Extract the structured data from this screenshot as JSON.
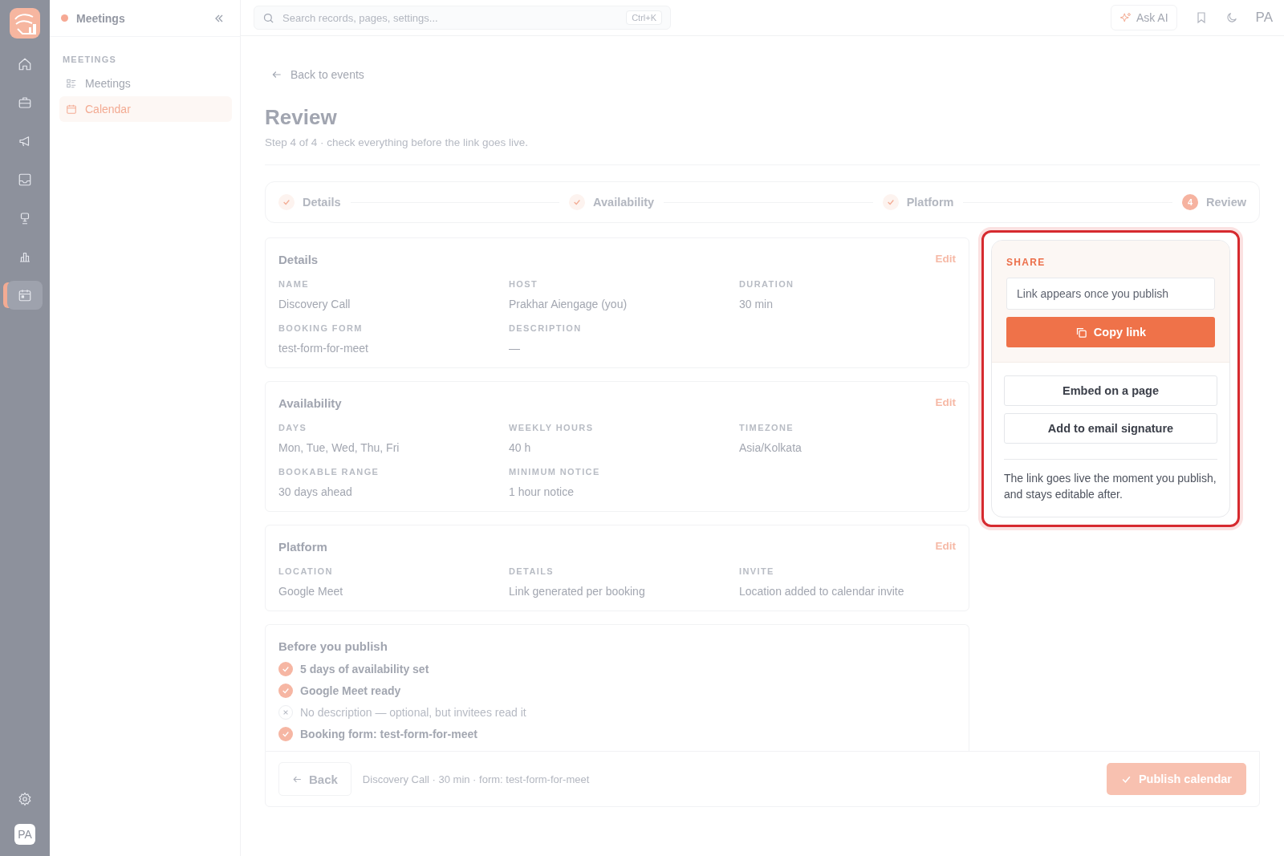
{
  "rail": {
    "items": [
      {
        "selected": false
      },
      {
        "selected": false
      },
      {
        "selected": false
      },
      {
        "selected": false
      },
      {
        "selected": false
      },
      {
        "selected": false
      },
      {
        "selected": true
      }
    ],
    "avatar": "PA"
  },
  "sidebar": {
    "title": "Meetings",
    "section": "MEETINGS",
    "items": [
      {
        "label": "Meetings",
        "selected": false
      },
      {
        "label": "Calendar",
        "selected": true
      }
    ]
  },
  "topbar": {
    "search": {
      "placeholder": "Search records, pages, settings...",
      "shortcut": "Ctrl+K"
    },
    "ask_ai": "Ask AI",
    "avatar": "PA"
  },
  "back_link": "Back to events",
  "title": "Review",
  "subtitle": "Step 4 of 4 · check everything before the link goes live.",
  "steps": [
    {
      "label": "Details",
      "completed": true
    },
    {
      "label": "Availability",
      "completed": true
    },
    {
      "label": "Platform",
      "completed": true
    },
    {
      "label": "Review",
      "completed": false,
      "number": "4"
    }
  ],
  "sections": [
    {
      "title": "Details",
      "edit": "Edit",
      "fields": [
        {
          "label": "NAME",
          "value": "Discovery Call"
        },
        {
          "label": "HOST",
          "value": "Prakhar Aiengage (you)"
        },
        {
          "label": "DURATION",
          "value": "30 min"
        },
        {
          "label": "BOOKING FORM",
          "value": "test-form-for-meet"
        },
        {
          "label": "DESCRIPTION",
          "value": "—"
        }
      ]
    },
    {
      "title": "Availability",
      "edit": "Edit",
      "fields": [
        {
          "label": "DAYS",
          "value": "Mon, Tue, Wed, Thu, Fri"
        },
        {
          "label": "WEEKLY HOURS",
          "value": "40 h"
        },
        {
          "label": "TIMEZONE",
          "value": "Asia/Kolkata"
        },
        {
          "label": "BOOKABLE RANGE",
          "value": "30 days ahead"
        },
        {
          "label": "MINIMUM NOTICE",
          "value": "1 hour notice"
        }
      ]
    },
    {
      "title": "Platform",
      "edit": "Edit",
      "fields": [
        {
          "label": "LOCATION",
          "value": "Google Meet"
        },
        {
          "label": "DETAILS",
          "value": "Link generated per booking"
        },
        {
          "label": "INVITE",
          "value": "Location added to calendar invite"
        }
      ]
    }
  ],
  "checklist": {
    "title": "Before you publish",
    "items": [
      {
        "text": "5 days of availability set",
        "ok": true
      },
      {
        "text": "Google Meet ready",
        "ok": true
      },
      {
        "text": "No description — optional, but invitees read it",
        "ok": false
      },
      {
        "text": "Booking form: test-form-for-meet",
        "ok": true
      }
    ]
  },
  "footer": {
    "back": "Back",
    "summary": "Discovery Call · 30 min · form: test-form-for-meet",
    "publish": "Publish calendar"
  },
  "share": {
    "highlighted": true,
    "label": "SHARE",
    "link_placeholder": "Link appears once you publish",
    "copy": "Copy link",
    "buttons": [
      "Embed on a page",
      "Add to email signature"
    ],
    "note": "The link goes live the moment you publish, and stays editable after."
  }
}
